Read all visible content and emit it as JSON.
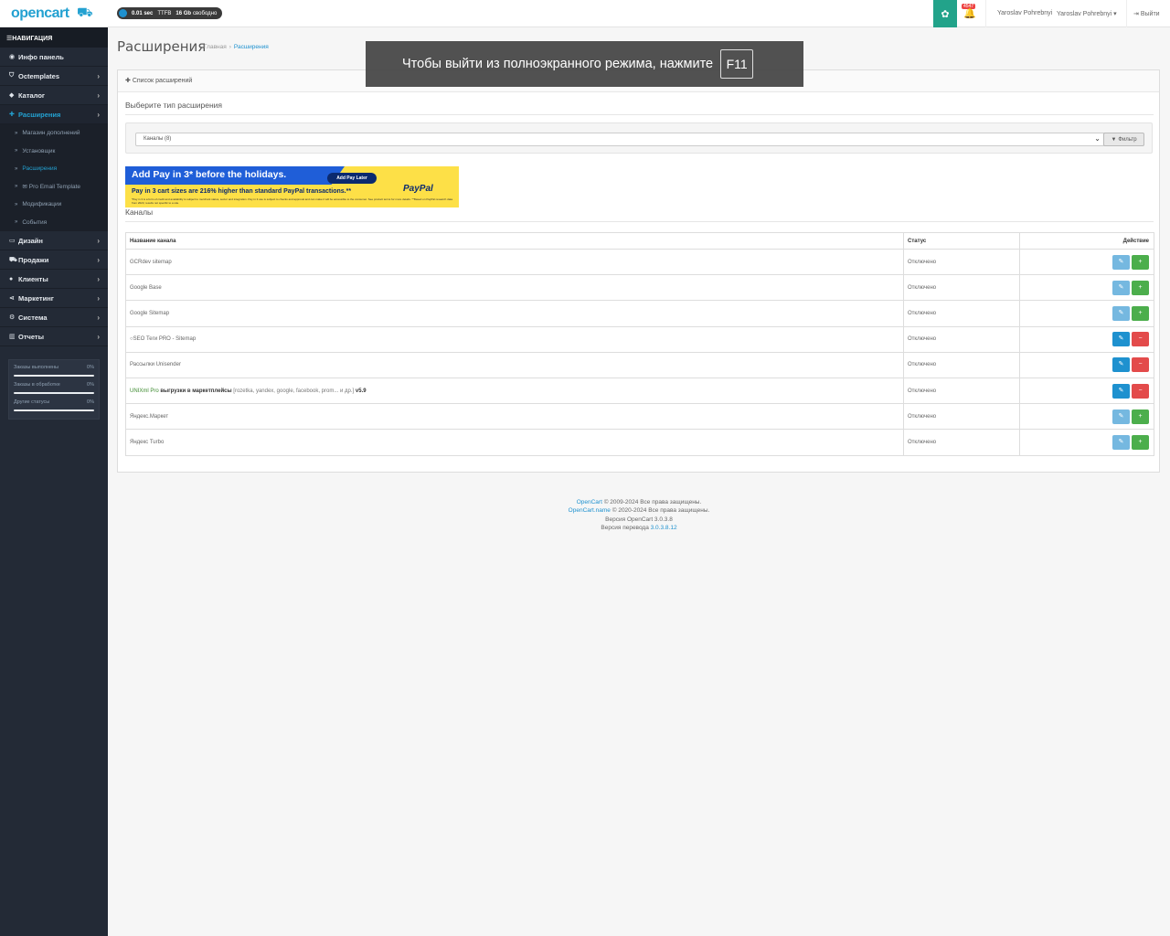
{
  "header": {
    "logo": "opencart",
    "perf_time": "0.01 sec",
    "perf_ttfb": "TTFB",
    "perf_space": "16 Gb",
    "perf_free": "свободно",
    "notif_count": "4547",
    "user1": "Yaroslav Pohrebnyi",
    "user2": "Yaroslav Pohrebnyi",
    "logout": "Выйти"
  },
  "sidebar": {
    "title": "НАВИГАЦИЯ",
    "items": [
      {
        "label": "Инфо панель",
        "icon": "dashboard-icon"
      },
      {
        "label": "Octemplates",
        "icon": "shield-icon"
      },
      {
        "label": "Каталог",
        "icon": "tag-icon"
      },
      {
        "label": "Расширения",
        "icon": "puzzle-icon"
      },
      {
        "label": "Дизайн",
        "icon": "monitor-icon"
      },
      {
        "label": "Продажи",
        "icon": "cart-icon"
      },
      {
        "label": "Клиенты",
        "icon": "user-icon"
      },
      {
        "label": "Маркетинг",
        "icon": "share-icon"
      },
      {
        "label": "Система",
        "icon": "gear-icon"
      },
      {
        "label": "Отчеты",
        "icon": "chart-icon"
      }
    ],
    "subitems": [
      "Магазин дополнений",
      "Установщик",
      "Расширения",
      "Pro Email Template",
      "Модификации",
      "События"
    ],
    "stats": [
      {
        "label": "Заказы выполнены",
        "value": "0%"
      },
      {
        "label": "Заказы в обработке",
        "value": "0%"
      },
      {
        "label": "Другие статусы",
        "value": "0%"
      }
    ]
  },
  "page": {
    "title": "Расширения",
    "breadcrumb_home": "Главная",
    "breadcrumb_current": "Расширения",
    "panel_heading": "Список расширений",
    "section_title": "Выберите тип расширения",
    "select_value": "Каналы (8)",
    "filter_label": "Фильтр",
    "channels_title": "Каналы"
  },
  "promo": {
    "headline": "Add Pay in 3* before the holidays.",
    "button": "Add Pay Later",
    "subline": "Pay in 3 cart sizes are 216% higher than standard PayPal transactions.**",
    "fineprint": "*Pay in 3 is a form of credit and availability is subject to merchant status, sector and integration. Pay in 3 use is subject to checks and approval and can make it will be accessible to the consumer. See product terms for more details. **Based on PayPal research data from 2023, results not specific to a site.",
    "brand": "PayPal"
  },
  "table": {
    "col_name": "Название канала",
    "col_status": "Статус",
    "col_action": "Действие",
    "rows": [
      {
        "name": "GCRdev sitemap",
        "status": "Отключено",
        "installed": false
      },
      {
        "name": "Google Base",
        "status": "Отключено",
        "installed": false
      },
      {
        "name": "Google Sitemap",
        "status": "Отключено",
        "installed": false
      },
      {
        "name": "SEO Теги PRO - Sitemap",
        "status": "Отключено",
        "installed": true
      },
      {
        "name": "Рассылки Unisender",
        "status": "Отключено",
        "installed": true
      },
      {
        "name_a": "UNIXml Pro",
        "name_b": "выгрузки в маркетплейсы",
        "name_c": "[rozetka, yandex, google, facebook, prom... и др.]",
        "name_d": "v5.9",
        "status": "Отключено",
        "installed": true
      },
      {
        "name": "Яндекс.Маркет",
        "status": "Отключено",
        "installed": false
      },
      {
        "name": "Яндекс Turbo",
        "status": "Отключено",
        "installed": false
      }
    ]
  },
  "footer": {
    "line1_link": "OpenCart",
    "line1_text": "© 2009-2024 Все права защищены.",
    "line2_link": "OpenCart.name",
    "line2_text": "© 2020-2024 Все права защищены.",
    "line3": "Версия OpenCart 3.0.3.8",
    "line4_text": "Версия перевода",
    "line4_link": "3.0.3.8.12"
  },
  "fullscreen": {
    "message": "Чтобы выйти из полноэкранного режима, нажмите",
    "key": "F11"
  },
  "colors": {
    "accent": "#23a1d1",
    "sidebar_bg": "#232a36",
    "edit_button": "#1e91cf",
    "install_button": "#4cae4c",
    "uninstall_button": "#e34b4b"
  }
}
